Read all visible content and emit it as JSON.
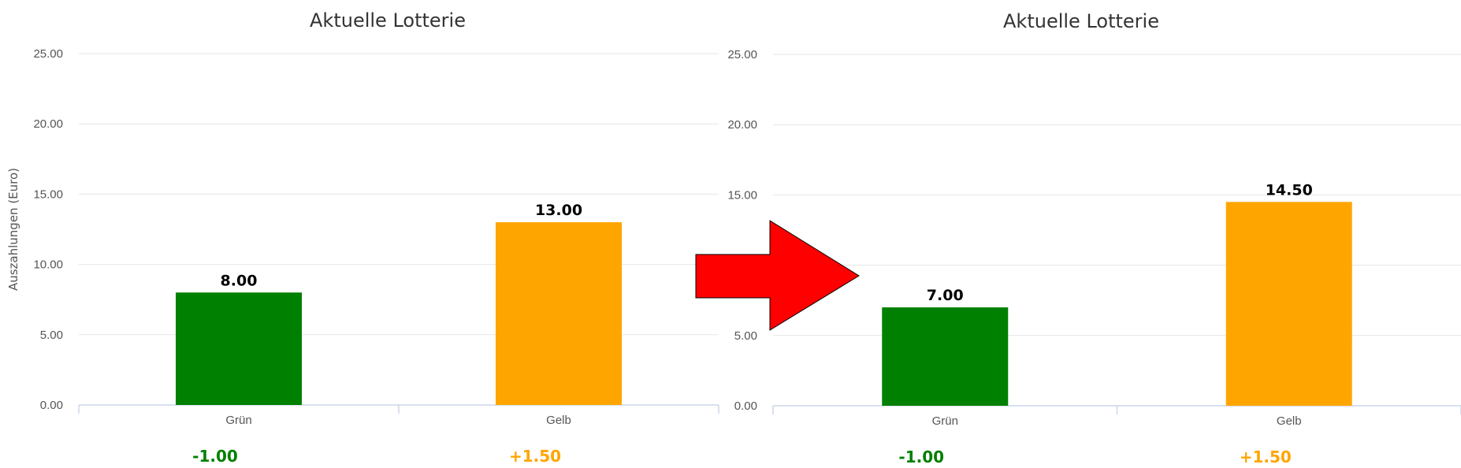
{
  "colors": {
    "green": "#008000",
    "orange": "#ffa500",
    "arrow_fill": "#ff0000",
    "arrow_stroke": "#000000",
    "grid": "#e6e6e6",
    "axis": "#ccd6eb"
  },
  "arrow": {
    "icon": "right-arrow-icon"
  },
  "chart_data": [
    {
      "type": "bar",
      "title": "Aktuelle Lotterie",
      "ylabel": "Auszahlungen (Euro)",
      "xlabel": "",
      "ylim": [
        0,
        25
      ],
      "ytick_values": [
        0,
        5,
        10,
        15,
        20,
        25
      ],
      "ytick_labels": [
        "0.00",
        "5.00",
        "10.00",
        "15.00",
        "20.00",
        "25.00"
      ],
      "grid": true,
      "categories": [
        "Grün",
        "Gelb"
      ],
      "values": [
        8.0,
        13.0
      ],
      "data_labels": [
        "8.00",
        "13.00"
      ],
      "bar_colors": [
        "#008000",
        "#ffa500"
      ],
      "deltas": [
        "-1.00",
        "+1.50"
      ],
      "delta_colors": [
        "#008000",
        "#ffa500"
      ]
    },
    {
      "type": "bar",
      "title": "Aktuelle Lotterie",
      "ylabel": "",
      "xlabel": "",
      "ylim": [
        0,
        25
      ],
      "ytick_values": [
        0,
        5,
        10,
        15,
        20,
        25
      ],
      "ytick_labels": [
        "0.00",
        "5.00",
        "10.00",
        "15.00",
        "20.00",
        "25.00"
      ],
      "grid": true,
      "categories": [
        "Grün",
        "Gelb"
      ],
      "values": [
        7.0,
        14.5
      ],
      "data_labels": [
        "7.00",
        "14.50"
      ],
      "bar_colors": [
        "#008000",
        "#ffa500"
      ],
      "deltas": [
        "-1.00",
        "+1.50"
      ],
      "delta_colors": [
        "#008000",
        "#ffa500"
      ]
    }
  ]
}
